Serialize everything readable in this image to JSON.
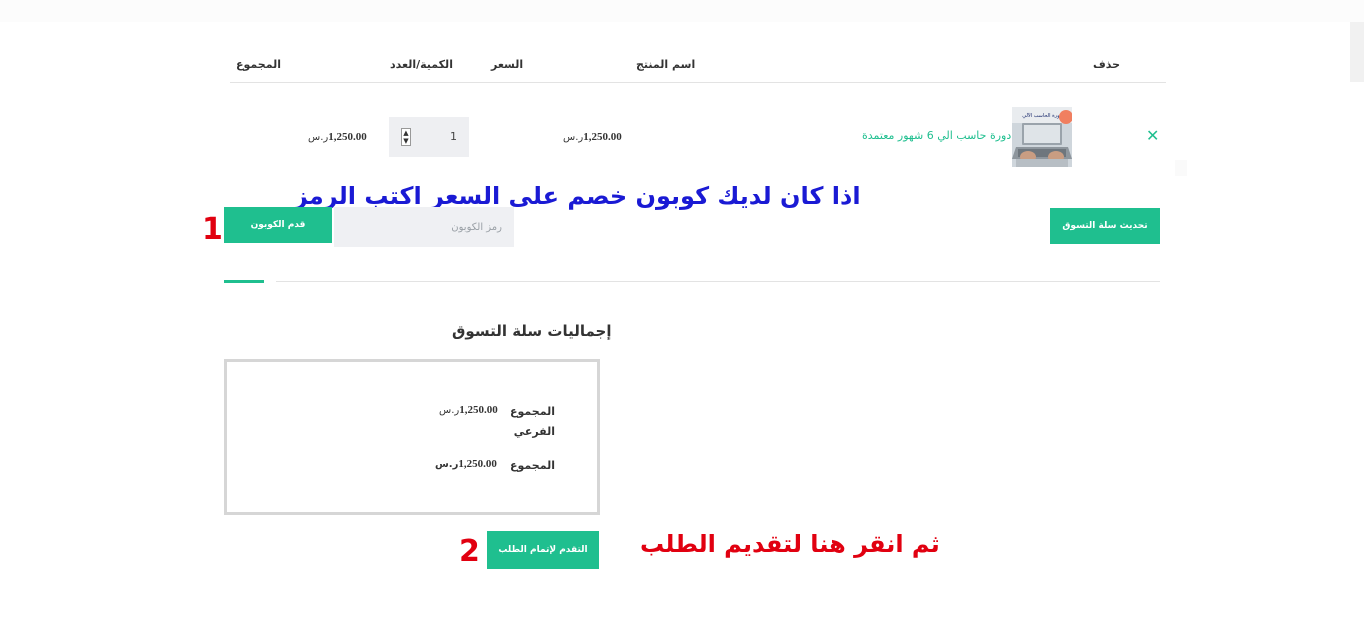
{
  "table": {
    "headers": {
      "remove": "حذف",
      "product": "اسم المنتج",
      "price": "السعر",
      "quantity": "الكمية/العدد",
      "total": "المجموع"
    },
    "row": {
      "remove_icon": "close-icon",
      "product_name": "دورة حاسب الي 6 شهور معتمدة",
      "thumbnail_text": "دورة الحاسب الآلي",
      "price_currency": "ر.س",
      "price_amount": "1,250.00",
      "quantity": "1",
      "total_currency": "ر.س",
      "total_amount": "1,250.00"
    }
  },
  "annotations": {
    "coupon_hint": "اذا كان لديك كوبون خصم على السعر اكتب الرمز",
    "checkout_hint": "ثم انقر هنا لتقديم الطلب",
    "step1": "1",
    "step2": "2"
  },
  "coupon": {
    "placeholder": "رمز الكوبون",
    "apply_label": "قدم الكوبون"
  },
  "update_cart_label": "تحديث سلة التسوق",
  "totals": {
    "title": "إجماليات سلة التسوق",
    "subtotal_label": "المجموع الفرعي",
    "subtotal_currency": "ر.س",
    "subtotal_amount": "1,250.00",
    "total_label": "المجموع",
    "total_currency": "ر.س",
    "total_amount": "1,250.00"
  },
  "checkout_label": "التقدم لإتمام الطلب",
  "colors": {
    "accent": "#1fbf8f",
    "annotation_blue": "#1a1ad4",
    "annotation_red": "#e10010"
  }
}
